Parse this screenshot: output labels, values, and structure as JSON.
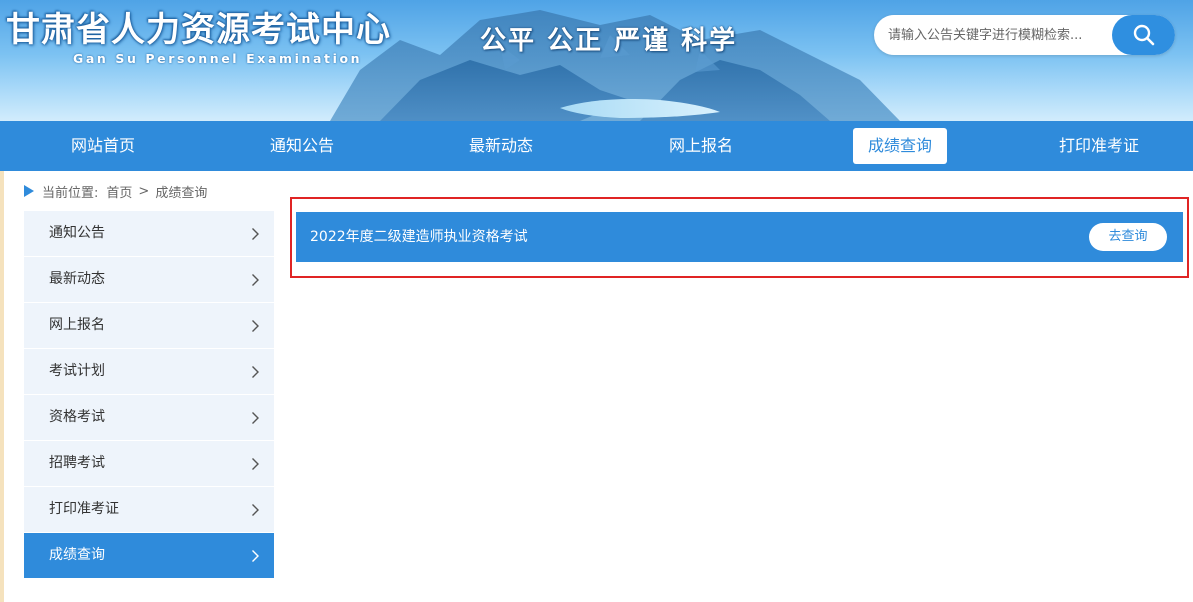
{
  "header": {
    "site_title": "甘肃省人力资源考试中心",
    "site_subtitle": "Gan Su Personnel Examination",
    "slogan": "公平 公正 严谨 科学",
    "search_placeholder": "请输入公告关键字进行模糊检索...",
    "search_icon": "search-icon"
  },
  "nav": {
    "items": [
      {
        "label": "网站首页"
      },
      {
        "label": "通知公告"
      },
      {
        "label": "最新动态"
      },
      {
        "label": "网上报名"
      },
      {
        "label": "成绩查询",
        "active": true
      },
      {
        "label": "打印准考证"
      }
    ]
  },
  "breadcrumb": {
    "prefix": "当前位置:",
    "home": "首页",
    "separator": ">",
    "current": "成绩查询"
  },
  "sidebar": {
    "items": [
      {
        "label": "通知公告"
      },
      {
        "label": "最新动态"
      },
      {
        "label": "网上报名"
      },
      {
        "label": "考试计划"
      },
      {
        "label": "资格考试"
      },
      {
        "label": "招聘考试"
      },
      {
        "label": "打印准考证"
      },
      {
        "label": "成绩查询",
        "active": true
      }
    ],
    "chevron_icon": "chevron-right-icon"
  },
  "content": {
    "exam_title": "2022年度二级建造师执业资格考试",
    "query_button": "去查询"
  },
  "colors": {
    "primary": "#2f8bdb",
    "sidebar_bg": "#eef4fb",
    "highlight": "#e02424"
  }
}
